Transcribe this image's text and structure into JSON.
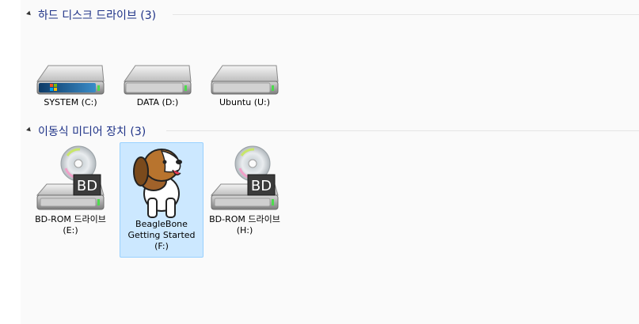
{
  "groups": [
    {
      "title": "하드 디스크 드라이브 (3)",
      "items": [
        {
          "label": "SYSTEM (C:)",
          "icon": "windows-hard-drive-icon"
        },
        {
          "label": "DATA (D:)",
          "icon": "hard-drive-icon"
        },
        {
          "label": "Ubuntu (U:)",
          "icon": "hard-drive-icon"
        }
      ]
    },
    {
      "title": "이동식 미디어 장치 (3)",
      "items": [
        {
          "label": "BD-ROM 드라이브 (E:)",
          "icon": "bd-rom-drive-icon",
          "badge": "BD"
        },
        {
          "label": "BeagleBone Getting Started (F:)",
          "icon": "beagleboard-dog-icon",
          "selected": true
        },
        {
          "label": "BD-ROM 드라이브 (H:)",
          "icon": "bd-rom-drive-icon",
          "badge": "BD"
        }
      ]
    }
  ],
  "colors": {
    "group_title": "#1e3287",
    "selection_fill": "#cce8ff",
    "selection_border": "#99d1ff"
  }
}
